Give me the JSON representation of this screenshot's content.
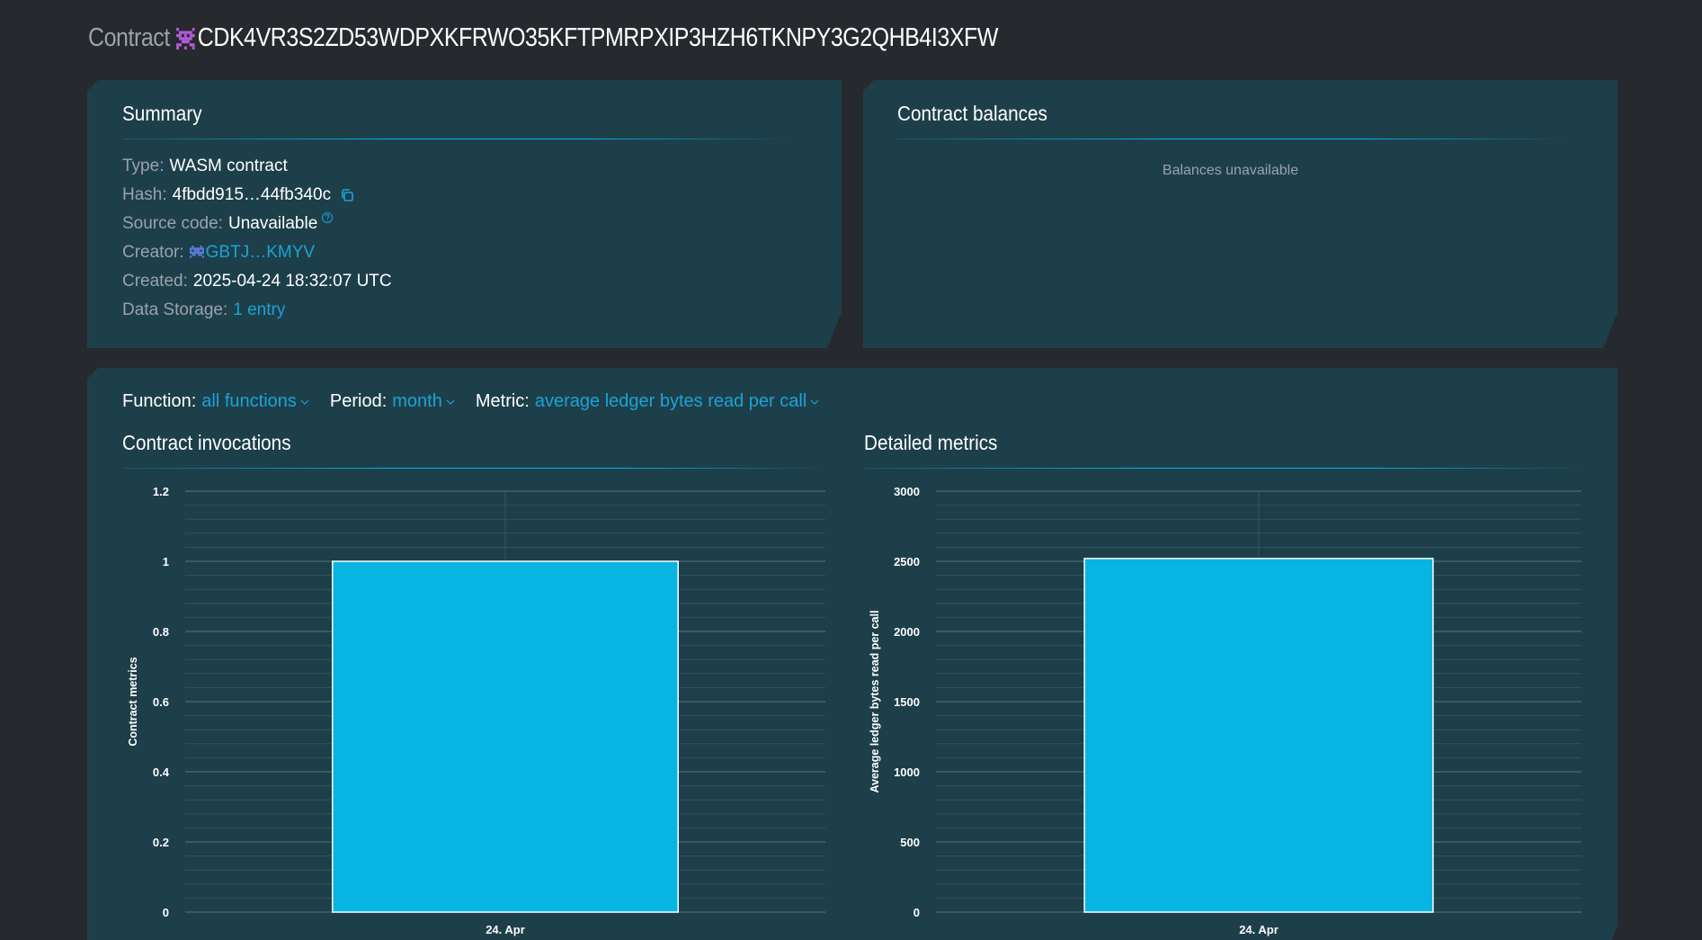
{
  "header": {
    "prefix": "Contract",
    "address": "CDK4VR3S2ZD53WDPXKFRWO35KFTPMRPXIP3HZH6TKNPY3G2QHB4I3XFW",
    "avatar_icon": "identicon-icon",
    "avatar_color": "#b05bd6"
  },
  "summary": {
    "title": "Summary",
    "type_label": "Type:",
    "type_value": "WASM contract",
    "hash_label": "Hash:",
    "hash_value": "4fbdd915…44fb340c",
    "hash_icon": "copy-icon",
    "source_label": "Source code:",
    "source_value": "Unavailable",
    "source_icon": "help-icon",
    "creator_label": "Creator:",
    "creator_value": "GBTJ…KMYV",
    "creator_icon": "identicon-icon",
    "created_label": "Created:",
    "created_value": "2025-04-24 18:32:07 UTC",
    "storage_label": "Data Storage:",
    "storage_value": "1 entry"
  },
  "balances": {
    "title": "Contract balances",
    "empty_text": "Balances unavailable"
  },
  "filters": {
    "function_label": "Function:",
    "function_value": "all functions",
    "period_label": "Period:",
    "period_value": "month",
    "metric_label": "Metric:",
    "metric_value": "average ledger bytes read per call"
  },
  "colors": {
    "accent": "#08b4e2",
    "link": "#1ba3d6",
    "card": "#1d3f4a",
    "background": "#26292d"
  },
  "chart_data": [
    {
      "type": "bar",
      "title": "Contract invocations",
      "ylabel": "Contract metrics",
      "xlabel": "",
      "categories": [
        "24. Apr"
      ],
      "values": [
        1
      ],
      "ylim": [
        0,
        1.2
      ],
      "yticks": [
        "0",
        "0.2",
        "0.4",
        "0.6",
        "0.8",
        "1",
        "1.2"
      ],
      "grid": true,
      "color": "#08b4e2"
    },
    {
      "type": "bar",
      "title": "Detailed metrics",
      "ylabel": "Average ledger bytes read per call",
      "xlabel": "",
      "categories": [
        "24. Apr"
      ],
      "values": [
        2520
      ],
      "ylim": [
        0,
        3000
      ],
      "yticks": [
        "0",
        "500",
        "1000",
        "1500",
        "2000",
        "2500",
        "3000"
      ],
      "grid": true,
      "color": "#08b4e2"
    }
  ]
}
